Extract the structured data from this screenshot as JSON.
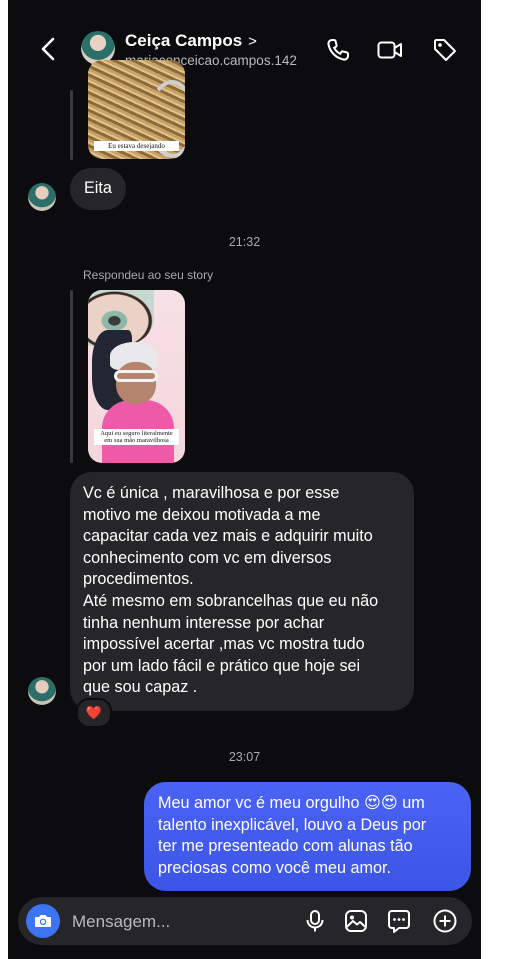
{
  "header": {
    "contact_name": "Ceiça Campos",
    "name_chevron": ">",
    "username": "mariaconceicao.campos.142",
    "icons": [
      "back-icon",
      "phone-icon",
      "video-icon",
      "tag-icon"
    ]
  },
  "thread": {
    "story_top_caption": "Eu estava desejando",
    "msg_eita": "Eita",
    "time_1": "21:32",
    "replied_label": "Respondeu ao seu story",
    "story_main_caption": "Aqui eu seguro literalmente em sua mão maravilhosa",
    "msg_long": "Vc é única , maravilhosa e por esse\nmotivo me deixou motivada a me\ncapacitar cada vez mais e adquirir muito\nconhecimento com vc em diversos\nprocedimentos.\nAté mesmo em sobrancelhas que eu não\ntinha nenhum interesse por achar\nimpossível acertar ,mas vc mostra tudo\npor um lado fácil e prático que hoje sei\nque sou capaz .",
    "reaction": "❤️",
    "time_2": "23:07",
    "msg_sent": "Meu amor vc é meu orgulho 😍😍 um\ntalento inexplicável, louvo a  Deus por\nter me presenteado com alunas tão\npreciosas como você meu amor."
  },
  "composer": {
    "placeholder": "Mensagem...",
    "icons": [
      "camera-icon",
      "microphone-icon",
      "gallery-icon",
      "sticker-icon",
      "plus-icon"
    ]
  },
  "colors": {
    "background": "#0c0c0e",
    "incoming_bubble": "#262628",
    "outgoing_bubble": "#3c55e6",
    "camera_button": "#3d74f4"
  }
}
